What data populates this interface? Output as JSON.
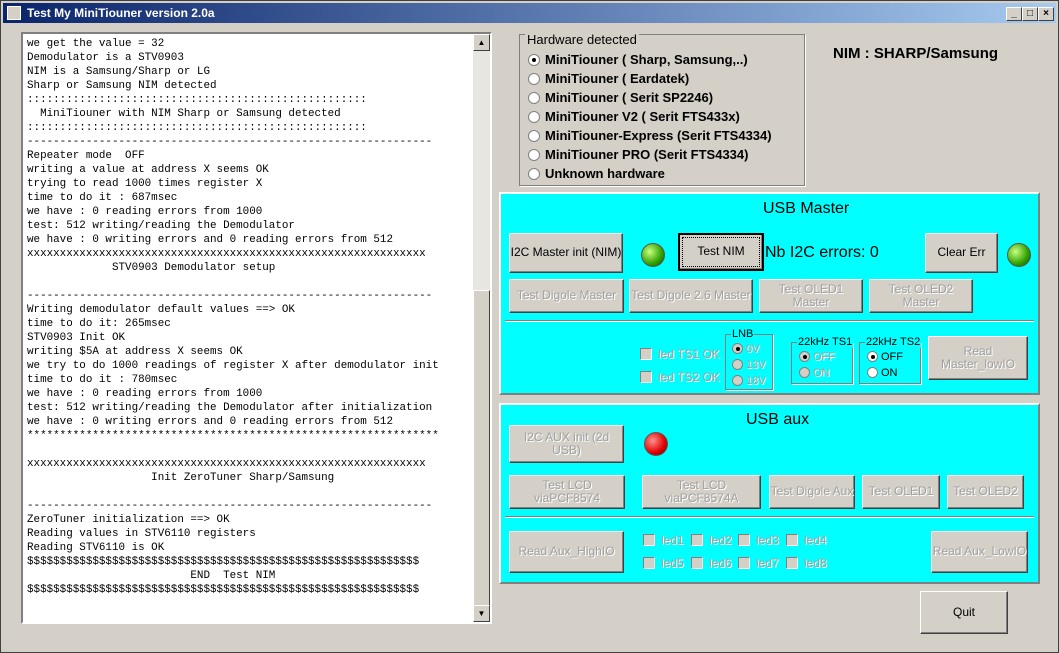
{
  "window": {
    "title": "Test My MiniTiouner version 2.0a",
    "controls": {
      "minimize": "_",
      "maximize": "□",
      "close": "×"
    }
  },
  "log": {
    "text": "we get the value = 32\nDemodulator is a STV0903\nNIM is a Samsung/Sharp or LG\nSharp or Samsung NIM detected\n::::::::::::::::::::::::::::::::::::::::::::::::::::\n  MiniTiouner with NIM Sharp or Samsung detected\n::::::::::::::::::::::::::::::::::::::::::::::::::::\n--------------------------------------------------------------\nRepeater mode  OFF\nwriting a value at address X seems OK\ntrying to read 1000 times register X\ntime to do it : 687msec\nwe have : 0 reading errors from 1000\ntest: 512 writing/reading the Demodulator\nwe have : 0 writing errors and 0 reading errors from 512\nxxxxxxxxxxxxxxxxxxxxxxxxxxxxxxxxxxxxxxxxxxxxxxxxxxxxxxxxxxxxx\n             STV0903 Demodulator setup\n\n--------------------------------------------------------------\nWriting demodulator default values ==> OK\ntime to do it: 265msec\nSTV0903 Init OK\nwriting $5A at address X seems OK\nwe try to do 1000 readings of register X after demodulator init\ntime to do it : 780msec\nwe have : 0 reading errors from 1000\ntest: 512 writing/reading the Demodulator after initialization\nwe have : 0 writing errors and 0 reading errors from 512\n***************************************************************\n\nxxxxxxxxxxxxxxxxxxxxxxxxxxxxxxxxxxxxxxxxxxxxxxxxxxxxxxxxxxxxx\n                   Init ZeroTuner Sharp/Samsung\n\n--------------------------------------------------------------\nZeroTuner initialization ==> OK\nReading values in STV6110 registers\nReading STV6110 is OK\n$$$$$$$$$$$$$$$$$$$$$$$$$$$$$$$$$$$$$$$$$$$$$$$$$$$$$$$$$$$$\n                         END  Test NIM\n$$$$$$$$$$$$$$$$$$$$$$$$$$$$$$$$$$$$$$$$$$$$$$$$$$$$$$$$$$$$"
  },
  "hardware": {
    "legend": "Hardware detected",
    "options": [
      {
        "label": "MiniTiouner ( Sharp, Samsung,..)",
        "selected": true
      },
      {
        "label": "MiniTiouner ( Eardatek)",
        "selected": false
      },
      {
        "label": "MiniTiouner ( Serit SP2246)",
        "selected": false
      },
      {
        "label": "MiniTiouner V2 ( Serit FTS433x)",
        "selected": false
      },
      {
        "label": "MiniTiouner-Express (Serit FTS4334)",
        "selected": false
      },
      {
        "label": "MiniTiouner PRO  (Serit FTS4334)",
        "selected": false
      },
      {
        "label": "Unknown hardware",
        "selected": false
      }
    ]
  },
  "nim_label": "NIM :  SHARP/Samsung",
  "usb_master": {
    "title": "USB Master",
    "i2c_init": "I2C Master init (NIM)",
    "init_led": "green",
    "test_nim": "Test NIM",
    "errors_label": "Nb I2C errors:  0",
    "clear_err": "Clear Err",
    "err_led": "green",
    "test_buttons": [
      "Test Digole Master",
      "Test Digole 2.6 Master",
      "Test OLED1 Master",
      "Test OLED2 Master"
    ],
    "led_ts1": "led TS1 OK",
    "led_ts2": "led TS2 OK",
    "lnb": {
      "label": "LNB",
      "options": [
        "0V",
        "13V",
        "18V"
      ],
      "selected": "0V"
    },
    "ts1": {
      "label": "22kHz TS1",
      "options": [
        "OFF",
        "ON"
      ],
      "selected": "OFF"
    },
    "ts2": {
      "label": "22kHz TS2",
      "options": [
        "OFF",
        "ON"
      ],
      "selected": "OFF"
    },
    "read_lowio": "Read Master_lowIO"
  },
  "usb_aux": {
    "title": "USB aux",
    "i2c_init": "I2C AUX init (2d USB)",
    "init_led": "red",
    "test_buttons": [
      "Test LCD  viaPCF8574",
      "Test LCD  viaPCF8574A",
      "Test Digole Aux",
      "Test OLED1",
      "Test OLED2"
    ],
    "read_high": "Read Aux_HighIO",
    "leds": [
      "led1",
      "led2",
      "led3",
      "led4",
      "led5",
      "led6",
      "led7",
      "led8"
    ],
    "read_low": "Read Aux_LowIO"
  },
  "quit": "Quit",
  "colors": {
    "panel": "#00ffff",
    "titlebar": "#0a246a",
    "led_green": "#30a000",
    "led_red": "#e00000"
  }
}
